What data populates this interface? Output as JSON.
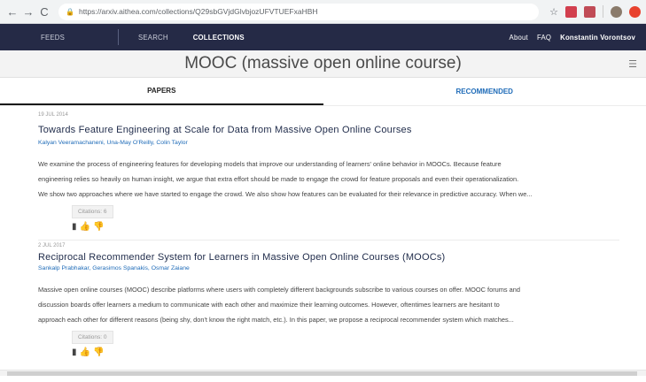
{
  "browser": {
    "url": "https://arxiv.aithea.com/collections/Q29sbGVjdGlvbjozUFVTUEFxaHBH",
    "back_icon": "←",
    "forward_icon": "→",
    "reload_icon": "C",
    "star_icon": "☆"
  },
  "nav": {
    "feeds": "FEEDS",
    "search": "SEARCH",
    "collections": "COLLECTIONS",
    "about": "About",
    "faq": "FAQ",
    "user": "Konstantin Vorontsov"
  },
  "collection": {
    "title": "MOOC (massive open online course)"
  },
  "tabs": {
    "papers": "PAPERS",
    "recommended": "RECOMMENDED"
  },
  "papers": [
    {
      "date": "19 JUL 2014",
      "title": "Towards Feature Engineering at Scale for Data from Massive Open Online Courses",
      "authors": "Kalyan Veeramachaneni, Una-May O'Reilly, Colin Taylor",
      "abstract_lines": [
        "We examine the process of engineering features for developing models that improve our understanding of learners' online behavior in MOOCs. Because feature",
        "engineering relies so heavily on human insight, we argue that extra effort should be made to engage the crowd for feature proposals and even their operationalization.",
        "We show two approaches where we have started to engage the crowd. We also show how features can be evaluated for their relevance in predictive accuracy. When we..."
      ],
      "citations": "Citations: 6"
    },
    {
      "date": "2 JUL 2017",
      "title": "Reciprocal Recommender System for Learners in Massive Open Online Courses (MOOCs)",
      "authors": "Sankalp Prabhakar, Gerasimos Spanakis, Osmar Zaiane",
      "abstract_lines": [
        "Massive open online courses (MOOC) describe platforms where users with completely different backgrounds subscribe to various courses on offer. MOOC forums and",
        "discussion boards offer learners a medium to communicate with each other and maximize their learning outcomes. However, oftentimes learners are hesitant to",
        "approach each other for different reasons (being shy, don't know the right match, etc.). In this paper, we propose a reciprocal recommender system which matches..."
      ],
      "citations": "Citations: 0"
    }
  ]
}
